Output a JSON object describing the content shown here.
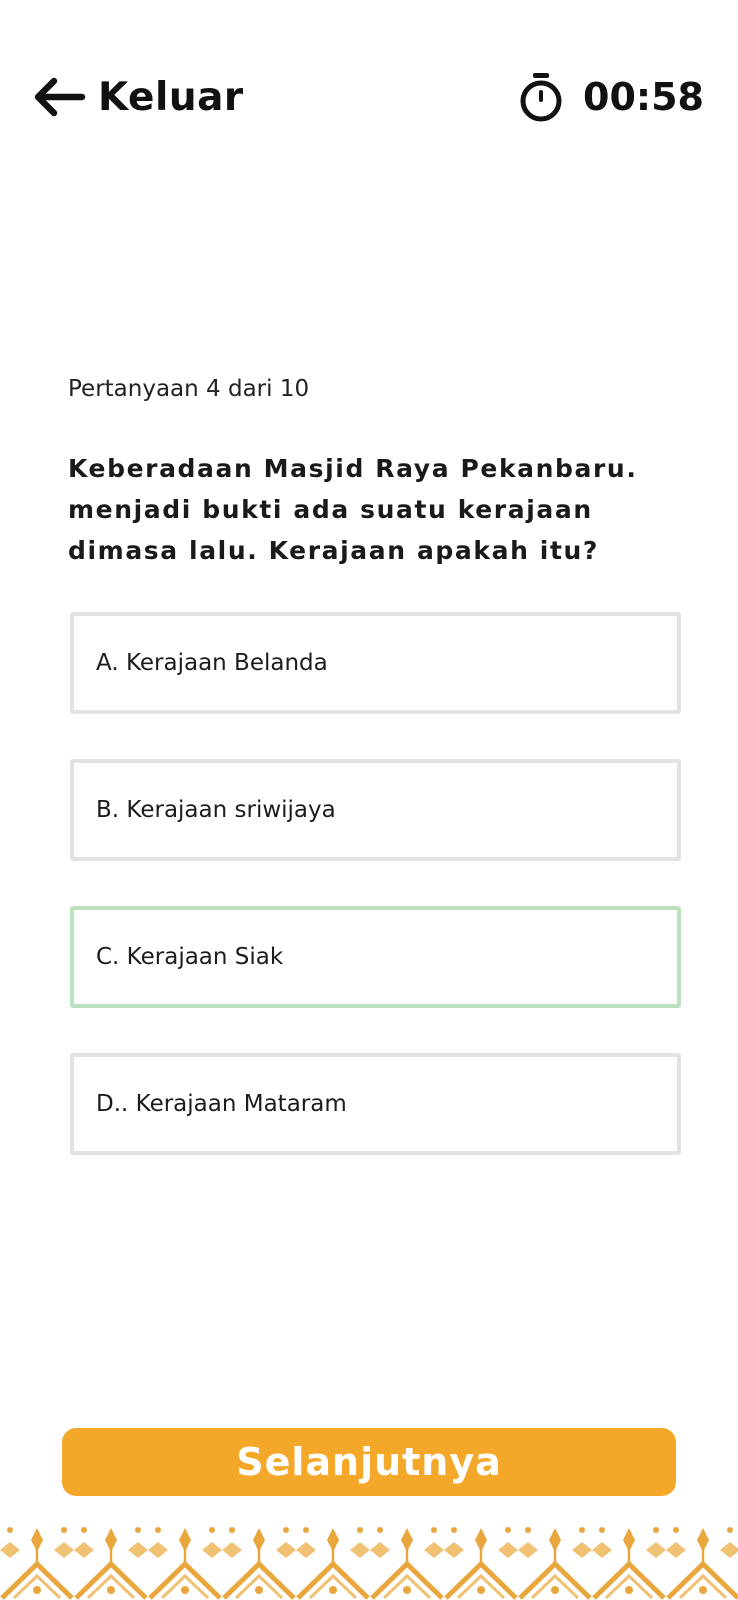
{
  "header": {
    "back_label": "Keluar",
    "back_icon": "arrow-left-icon",
    "timer_icon": "stopwatch-icon",
    "timer_value": "00:58"
  },
  "quiz": {
    "counter": "Pertanyaan 4 dari 10",
    "question": "Keberadaan Masjid Raya Pekanbaru. menjadi bukti ada suatu kerajaan dimasa lalu. Kerajaan apakah itu?",
    "options": [
      {
        "label": "A. Kerajaan Belanda"
      },
      {
        "label": "B. Kerajaan sriwijaya"
      },
      {
        "label": "C. Kerajaan Siak"
      },
      {
        "label": "D.. Kerajaan Mataram"
      }
    ],
    "selected_option": "C. Kerajaan Siak"
  },
  "footer": {
    "next_label": "Selanjutnya",
    "ornament": "songket-pattern"
  },
  "colors": {
    "accent": "#f4a82a",
    "selected_border": "#bfe0c0",
    "option_border": "#e2e2e2",
    "ornament": "#e9a63c"
  }
}
